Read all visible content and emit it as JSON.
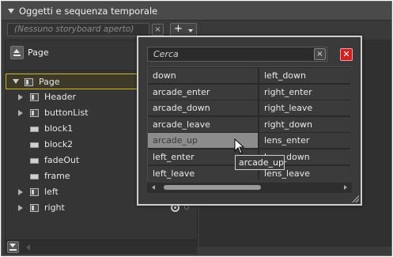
{
  "panel": {
    "title": "Oggetti e sequenza temporale"
  },
  "storyboard": {
    "combo_text": "(Nessuno storyboard aperto)",
    "clear_label": "×",
    "add_label": "+"
  },
  "scope": {
    "label": "Page"
  },
  "tree": [
    {
      "label": "Page",
      "icon": "panel-icon",
      "expander": "open",
      "indent": 0,
      "selected": true
    },
    {
      "label": "Header",
      "icon": "panel-icon",
      "expander": "closed",
      "indent": 1
    },
    {
      "label": "buttonList",
      "icon": "panel-icon",
      "expander": "closed",
      "indent": 1
    },
    {
      "label": "block1",
      "icon": "block-icon",
      "expander": "none",
      "indent": 1
    },
    {
      "label": "block2",
      "icon": "block-icon",
      "expander": "none",
      "indent": 1
    },
    {
      "label": "fadeOut",
      "icon": "block-icon",
      "expander": "none",
      "indent": 1
    },
    {
      "label": "frame",
      "icon": "block-icon",
      "expander": "none",
      "indent": 1
    },
    {
      "label": "left",
      "icon": "panel-icon",
      "expander": "closed",
      "indent": 1
    },
    {
      "label": "right",
      "icon": "panel-icon",
      "expander": "closed",
      "indent": 1,
      "eye": true
    }
  ],
  "picker": {
    "search_placeholder": "Cerca",
    "clear_label": "×",
    "close_label": "✕",
    "columns": [
      [
        "down",
        "arcade_enter",
        "arcade_down",
        "arcade_leave",
        "arcade_up",
        "left_enter",
        "left_leave"
      ],
      [
        "left_down",
        "right_enter",
        "right_leave",
        "right_down",
        "lens_enter",
        "lens_down",
        "lens_leave"
      ]
    ],
    "highlighted": "arcade_up",
    "tooltip": "arcade_up"
  },
  "colors": {
    "selection_border": "#c9b82a",
    "close_button": "#d21f1f",
    "highlight": "#8c8c8c"
  }
}
